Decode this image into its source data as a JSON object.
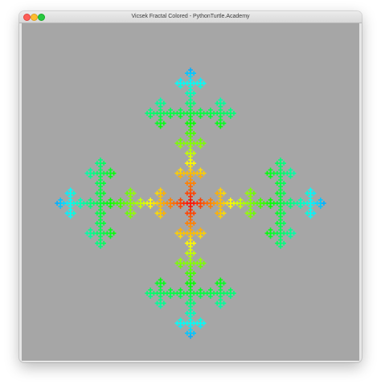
{
  "window": {
    "title": "Vicsek Fractal Colored - PythonTurtle.Academy",
    "controls": [
      "close",
      "minimize",
      "zoom"
    ]
  },
  "canvas": {
    "background": "#a6a6a6",
    "fractal": {
      "name": "Vicsek fractal",
      "color_mode": "rainbow hue by distance from center",
      "center_color": "#ff3300",
      "edge_color": "#cc00ff"
    }
  }
}
